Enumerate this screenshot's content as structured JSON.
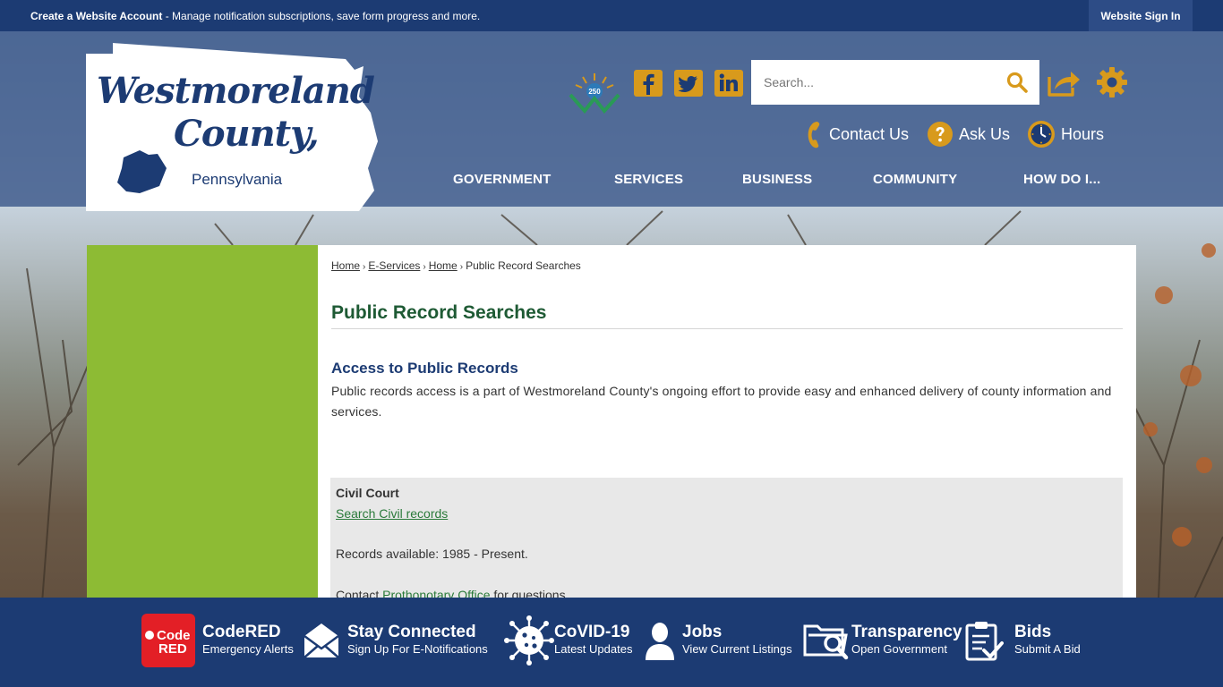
{
  "topbar": {
    "create_account": "Create a Website Account",
    "create_account_desc": " - Manage notification subscriptions, save form progress and more.",
    "sign_in": "Website Sign In"
  },
  "logo": {
    "line1": "Westmoreland",
    "line2": "County,",
    "line3": "Pennsylvania"
  },
  "header": {
    "social_icons": [
      "facebook-icon",
      "twitter-icon",
      "linkedin-icon"
    ],
    "search_placeholder": "Search...",
    "quick_links": [
      {
        "label": "Contact Us",
        "icon": "phone-icon"
      },
      {
        "label": "Ask Us",
        "icon": "question-icon"
      },
      {
        "label": "Hours",
        "icon": "clock-icon"
      }
    ],
    "nav": [
      "GOVERNMENT",
      "SERVICES",
      "BUSINESS",
      "COMMUNITY",
      "HOW DO I..."
    ]
  },
  "breadcrumb": {
    "items": [
      "Home",
      "E-Services",
      "Home"
    ],
    "current": "Public Record Searches"
  },
  "main": {
    "title": "Public Record Searches",
    "section_heading": "Access to Public Records",
    "intro": "Public records access is a part of Westmoreland County's ongoing effort to provide easy and enhanced delivery of county information and  services.",
    "civil": {
      "title": "Civil Court",
      "link": "Search Civil records",
      "records": "Records available: 1985 - Present.",
      "contact_prefix": "Contact ",
      "contact_link": "Prothonotary Office",
      "contact_suffix": " for questions."
    }
  },
  "footer": {
    "items": [
      {
        "title": "CodeRED",
        "subtitle": "Emergency Alerts",
        "icon": "codered-icon"
      },
      {
        "title": "Stay Connected",
        "subtitle": "Sign Up For E-Notifications",
        "icon": "envelope-icon"
      },
      {
        "title": "CoVID-19",
        "subtitle": "Latest Updates",
        "icon": "virus-icon"
      },
      {
        "title": "Jobs",
        "subtitle": "View Current Listings",
        "icon": "person-icon"
      },
      {
        "title": "Transparency",
        "subtitle": "Open Government",
        "icon": "folder-search-icon"
      },
      {
        "title": "Bids",
        "subtitle": "Submit A Bid",
        "icon": "clipboard-check-icon"
      }
    ],
    "codered_logo": [
      "Code",
      "RED"
    ]
  },
  "colors": {
    "navy": "#1c3b73",
    "gold": "#d89a1c",
    "green_sidebar": "#8dbb34",
    "title_green": "#1e5a34"
  }
}
